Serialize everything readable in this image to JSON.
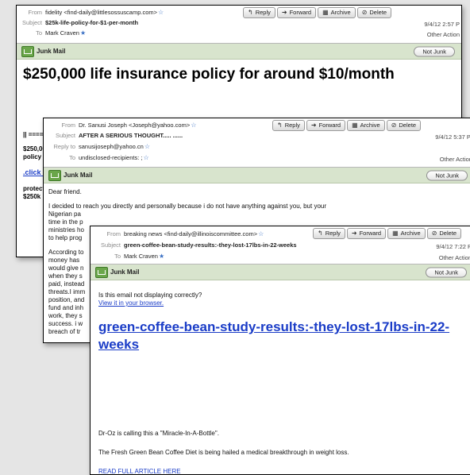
{
  "w1": {
    "from_label": "From",
    "from": "fidelity <find-daily@littlesossuscamp.com>",
    "subject_label": "Subject",
    "subject": "$25k-life-policy-for-$1-per-month",
    "to_label": "To",
    "to": "Mark Craven",
    "date": "9/4/12 2:57 P",
    "other_actions": "Other Action",
    "toolbar": {
      "reply": "Reply",
      "forward": "Forward",
      "archive": "Archive",
      "delete": "Delete"
    },
    "junk_label": "Junk Mail",
    "not_junk": "Not Junk",
    "headline": "$250,000 life insurance policy for around $10/month",
    "separator": "|| ====",
    "offer": "$250,00\npolicy f",
    "click_link": ".click h",
    "protect": "protect\n$250k p"
  },
  "w2": {
    "from_label": "From",
    "from": "Dr. Sanusi Joseph <Joseph@yahoo.com>",
    "subject_label": "Subject",
    "subject": "AFTER A SERIOUS THOUGHT..... ......",
    "replyto_label": "Reply to",
    "replyto": "sanusijoseph@yahoo.cn",
    "to_label": "To",
    "to": "undisclosed-recipients: ;",
    "date": "9/4/12 5:37 PI",
    "other_actions": "Other Action",
    "toolbar": {
      "reply": "Reply",
      "forward": "Forward",
      "archive": "Archive",
      "delete": "Delete"
    },
    "junk_label": "Junk Mail",
    "not_junk": "Not Junk",
    "greeting": "Dear friend.",
    "para1_l1": "I decided to reach you directly and personally because i do not have anything against you, but your",
    "para1_l2": "Nigerian pa",
    "para1_l3": "time in the p",
    "para1_l4": "ministries ho",
    "para1_l5": "to help prog",
    "para2": [
      "According to",
      "money has",
      "would give n",
      "when they s",
      "paid, instead",
      "threats.I imm",
      "position, and",
      "fund and inh",
      "work, they s",
      "success. i w",
      "breach of tr"
    ]
  },
  "w3": {
    "from_label": "From",
    "from": "breaking news <find-daily@illinoiscommittee.com>",
    "subject_label": "Subject",
    "subject": "green-coffee-bean-study-results:-they-lost-17lbs-in-22-weeks",
    "to_label": "To",
    "to": "Mark Craven",
    "date": "9/4/12 7:22 P",
    "other_actions": "Other Action",
    "toolbar": {
      "reply": "Reply",
      "forward": "Forward",
      "archive": "Archive",
      "delete": "Delete"
    },
    "junk_label": "Junk Mail",
    "not_junk": "Not Junk",
    "display_q": "Is this email not displaying correctly?",
    "view_browser": "View it in your browser.",
    "big_title": "green-coffee-bean-study-results:-they-lost-17lbs-in-22-weeks",
    "drOz": "Dr-Oz is calling this a \"Miracle-In-A-Bottle\".",
    "fresh": "The Fresh Green Bean Coffee Diet is being hailed a medical breakthrough in weight loss.",
    "read_more": "READ FULL ARTICLE HERE"
  }
}
